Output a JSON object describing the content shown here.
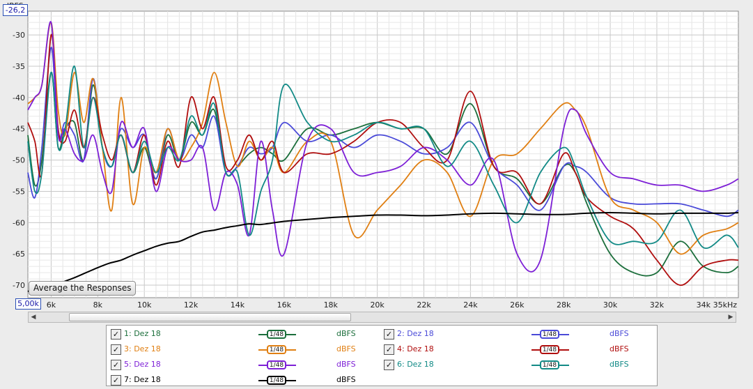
{
  "title": "",
  "axis": {
    "unit_label": "dBFS",
    "top_value": "-26,2",
    "start_freq": "5,00k",
    "y_ticks": [
      "-30",
      "-35",
      "-40",
      "-45",
      "-50",
      "-55",
      "-60",
      "-65",
      "-70"
    ],
    "x_ticks": [
      "6k",
      "8k",
      "10k",
      "12k",
      "14k",
      "16k",
      "18k",
      "20k",
      "22k",
      "24k",
      "26k",
      "28k",
      "30k",
      "32k",
      "34k",
      "35kHz"
    ]
  },
  "average_button": "Average the Responses",
  "colors": {
    "background": "#ffffff",
    "grid": "#d7d7d7",
    "axis": "#777777"
  },
  "legend": [
    {
      "label": "1: Dez 18",
      "smoothing": "1/48",
      "unit": "dBFS",
      "color": "#1b6e3b",
      "checked": true
    },
    {
      "label": "2: Dez 18",
      "smoothing": "1/48",
      "unit": "dBFS",
      "color": "#4a4ad8",
      "checked": true
    },
    {
      "label": "3: Dez 18",
      "smoothing": "1/48",
      "unit": "dBFS",
      "color": "#e07f12",
      "checked": true
    },
    {
      "label": "4: Dez 18",
      "smoothing": "1/48",
      "unit": "dBFS",
      "color": "#b00e0e",
      "checked": true
    },
    {
      "label": "5: Dez 18",
      "smoothing": "1/48",
      "unit": "dBFS",
      "color": "#7d1fd6",
      "checked": true
    },
    {
      "label": "6: Dez 18",
      "smoothing": "1/48",
      "unit": "dBFS",
      "color": "#128a86",
      "checked": true
    },
    {
      "label": "7: Dez 18",
      "smoothing": "1/48",
      "unit": "dBFS",
      "color": "#000000",
      "checked": true
    }
  ],
  "chart_data": {
    "type": "line",
    "xlabel": "kHz",
    "ylabel": "dBFS",
    "xlim": [
      5,
      35.5
    ],
    "ylim": [
      -72,
      -26.2
    ],
    "grid": true,
    "series": [
      {
        "name": "1: Dez 18",
        "color": "#1b6e3b",
        "x": [
          5.0,
          5.3,
          5.6,
          6.0,
          6.3,
          6.6,
          7.0,
          7.4,
          7.8,
          8.2,
          8.6,
          9.0,
          9.5,
          10.0,
          10.5,
          11.0,
          11.5,
          12.0,
          12.5,
          13.0,
          13.5,
          14.0,
          14.5,
          15.0,
          15.5,
          16.0,
          17.0,
          18.0,
          19.0,
          20.0,
          21.0,
          22.0,
          23.0,
          24.0,
          25.0,
          26.0,
          27.0,
          28.0,
          28.5,
          29.0,
          30.0,
          31.0,
          32.0,
          33.0,
          34.0,
          35.0,
          35.5
        ],
        "y": [
          -46,
          -54,
          -50,
          -36,
          -48,
          -45,
          -44,
          -50,
          -38,
          -48,
          -51,
          -46,
          -52,
          -48,
          -53,
          -46,
          -50,
          -44,
          -46,
          -42,
          -52,
          -51,
          -49,
          -48,
          -49,
          -50,
          -45,
          -46,
          -45,
          -44,
          -45,
          -45,
          -49,
          -41,
          -51,
          -53,
          -57,
          -51,
          -52,
          -57,
          -65,
          -68,
          -68,
          -63,
          -67,
          -68,
          -67
        ]
      },
      {
        "name": "2: Dez 18",
        "color": "#4a4ad8",
        "x": [
          5.0,
          5.3,
          5.6,
          6.0,
          6.3,
          6.6,
          7.0,
          7.4,
          7.8,
          8.2,
          8.6,
          9.0,
          9.5,
          10.0,
          10.5,
          11.0,
          11.5,
          12.0,
          12.5,
          13.0,
          13.5,
          14.0,
          14.5,
          15.0,
          15.5,
          16.0,
          17.0,
          18.0,
          19.0,
          20.0,
          21.0,
          22.0,
          23.0,
          24.0,
          25.0,
          26.0,
          27.0,
          28.0,
          28.5,
          29.0,
          30.0,
          31.0,
          32.0,
          33.0,
          34.0,
          35.0,
          35.5
        ],
        "y": [
          -52,
          -56,
          -48,
          -32,
          -46,
          -44,
          -46,
          -50,
          -37,
          -48,
          -51,
          -45,
          -48,
          -46,
          -53,
          -45,
          -50,
          -46,
          -48,
          -43,
          -52,
          -51,
          -48,
          -49,
          -48,
          -44,
          -47,
          -46,
          -48,
          -46,
          -47,
          -49,
          -48,
          -44,
          -51,
          -54,
          -58,
          -51,
          -51,
          -52,
          -56,
          -57,
          -57,
          -57,
          -58,
          -59,
          -58
        ]
      },
      {
        "name": "3: Dez 18",
        "color": "#e07f12",
        "x": [
          5.0,
          5.3,
          5.6,
          6.0,
          6.3,
          6.6,
          7.0,
          7.4,
          7.8,
          8.2,
          8.6,
          9.0,
          9.5,
          10.0,
          10.5,
          11.0,
          11.5,
          12.0,
          12.5,
          13.0,
          13.5,
          14.0,
          14.5,
          15.0,
          15.5,
          16.0,
          17.0,
          18.0,
          19.0,
          20.0,
          21.0,
          22.0,
          23.0,
          24.0,
          25.0,
          26.0,
          27.0,
          28.0,
          28.5,
          29.0,
          30.0,
          31.0,
          32.0,
          33.0,
          34.0,
          35.0,
          35.5
        ],
        "y": [
          -41,
          -40,
          -38,
          -28,
          -42,
          -46,
          -36,
          -44,
          -37,
          -48,
          -58,
          -40,
          -57,
          -48,
          -52,
          -45,
          -50,
          -48,
          -44,
          -36,
          -44,
          -51,
          -47,
          -50,
          -48,
          -52,
          -47,
          -47,
          -62,
          -58,
          -54,
          -50,
          -52,
          -59,
          -50,
          -49,
          -45,
          -41,
          -42,
          -45,
          -56,
          -58,
          -60,
          -65,
          -62,
          -61,
          -60
        ]
      },
      {
        "name": "4: Dez 18",
        "color": "#b00e0e",
        "x": [
          5.0,
          5.3,
          5.6,
          6.0,
          6.3,
          6.6,
          7.0,
          7.4,
          7.8,
          8.2,
          8.6,
          9.0,
          9.5,
          10.0,
          10.5,
          11.0,
          11.5,
          12.0,
          12.5,
          13.0,
          13.5,
          14.0,
          14.5,
          15.0,
          15.5,
          16.0,
          17.0,
          18.0,
          19.0,
          20.0,
          21.0,
          22.0,
          23.0,
          24.0,
          25.0,
          26.0,
          27.0,
          28.0,
          28.5,
          29.0,
          30.0,
          31.0,
          32.0,
          33.0,
          34.0,
          35.0,
          35.5
        ],
        "y": [
          -44,
          -47,
          -52,
          -30,
          -45,
          -47,
          -42,
          -48,
          -40,
          -46,
          -50,
          -46,
          -52,
          -46,
          -54,
          -47,
          -51,
          -40,
          -45,
          -40,
          -51,
          -50,
          -46,
          -50,
          -47,
          -52,
          -49,
          -49,
          -47,
          -44,
          -44,
          -48,
          -50,
          -39,
          -51,
          -52,
          -57,
          -49,
          -52,
          -56,
          -59,
          -61,
          -66,
          -70,
          -67,
          -66,
          -66
        ]
      },
      {
        "name": "5: Dez 18",
        "color": "#7d1fd6",
        "x": [
          5.0,
          5.3,
          5.6,
          6.0,
          6.3,
          6.6,
          7.0,
          7.4,
          7.8,
          8.2,
          8.6,
          9.0,
          9.5,
          10.0,
          10.5,
          11.0,
          11.5,
          12.0,
          12.5,
          13.0,
          13.5,
          14.0,
          14.5,
          15.0,
          15.5,
          16.0,
          17.0,
          18.0,
          19.0,
          20.0,
          21.0,
          22.0,
          23.0,
          24.0,
          25.0,
          26.0,
          27.0,
          28.0,
          28.5,
          29.0,
          30.0,
          31.0,
          32.0,
          33.0,
          34.0,
          35.0,
          35.5
        ],
        "y": [
          -42,
          -40,
          -38,
          -28,
          -46,
          -45,
          -49,
          -50,
          -46,
          -52,
          -55,
          -44,
          -48,
          -45,
          -55,
          -48,
          -50,
          -50,
          -48,
          -58,
          -52,
          -54,
          -62,
          -47,
          -58,
          -65,
          -47,
          -45,
          -52,
          -52,
          -51,
          -48,
          -50,
          -54,
          -50,
          -65,
          -66,
          -45,
          -42,
          -46,
          -52,
          -53,
          -54,
          -54,
          -55,
          -54,
          -53
        ]
      },
      {
        "name": "6: Dez 18",
        "color": "#128a86",
        "x": [
          5.0,
          5.3,
          5.6,
          6.0,
          6.3,
          6.6,
          7.0,
          7.4,
          7.8,
          8.2,
          8.6,
          9.0,
          9.5,
          10.0,
          10.5,
          11.0,
          11.5,
          12.0,
          12.5,
          13.0,
          13.5,
          14.0,
          14.5,
          15.0,
          15.5,
          16.0,
          17.0,
          18.0,
          19.0,
          20.0,
          21.0,
          22.0,
          23.0,
          24.0,
          25.0,
          26.0,
          27.0,
          28.0,
          28.5,
          29.0,
          30.0,
          31.0,
          32.0,
          33.0,
          34.0,
          35.0,
          35.5
        ],
        "y": [
          -47,
          -55,
          -52,
          -36,
          -48,
          -45,
          -35,
          -48,
          -40,
          -48,
          -51,
          -46,
          -52,
          -47,
          -52,
          -48,
          -50,
          -43,
          -46,
          -41,
          -52,
          -52,
          -62,
          -55,
          -50,
          -38,
          -44,
          -47,
          -46,
          -44,
          -45,
          -45,
          -51,
          -47,
          -54,
          -60,
          -52,
          -48,
          -51,
          -56,
          -63,
          -63,
          -63,
          -58,
          -64,
          -62,
          -64
        ]
      },
      {
        "name": "7: Dez 18",
        "color": "#000000",
        "x": [
          5.0,
          5.5,
          6.0,
          6.5,
          7.0,
          7.5,
          8.0,
          8.5,
          9.0,
          9.5,
          10.0,
          10.5,
          11.0,
          11.5,
          12.0,
          12.5,
          13.0,
          13.5,
          14.0,
          14.5,
          15.0,
          16.0,
          17.0,
          18.0,
          19.0,
          20.0,
          21.0,
          22.0,
          23.0,
          24.0,
          25.0,
          26.0,
          27.0,
          28.0,
          29.0,
          30.0,
          31.0,
          32.0,
          33.0,
          34.0,
          35.0,
          35.5
        ],
        "y": [
          -71,
          -70.5,
          -70.2,
          -69.5,
          -68.8,
          -68,
          -67.2,
          -66.5,
          -66,
          -65.2,
          -64.5,
          -63.8,
          -63.3,
          -63,
          -62.2,
          -61.5,
          -61.2,
          -60.8,
          -60.5,
          -60.2,
          -60.3,
          -59.8,
          -59.5,
          -59.2,
          -59,
          -58.8,
          -58.8,
          -58.9,
          -58.8,
          -58.6,
          -58.5,
          -58.6,
          -58.7,
          -58.7,
          -58.5,
          -58.4,
          -58.5,
          -58.6,
          -58.5,
          -58.5,
          -58.5,
          -58.4
        ]
      }
    ]
  }
}
